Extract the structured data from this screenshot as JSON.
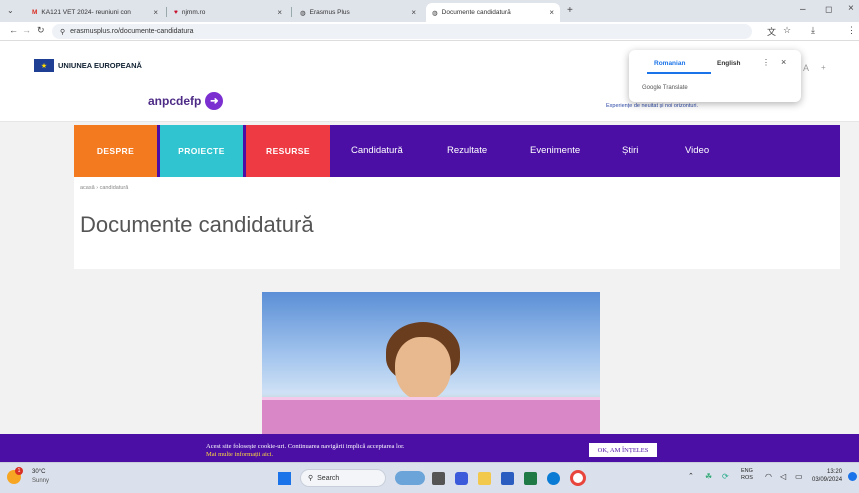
{
  "browser": {
    "tabs": [
      {
        "title": "KA121 VET 2024- reuniuni con"
      },
      {
        "title": "njmm.ro"
      },
      {
        "title": "Erasmus Plus"
      },
      {
        "title": "Documente candidatură"
      }
    ],
    "url": "erasmusplus.ro/documente-candidatura",
    "new_tab": "+",
    "close_glyph": "×"
  },
  "translate": {
    "source": "Romanian",
    "target": "English",
    "label": "Google Translate",
    "letter": "A",
    "plus": "+"
  },
  "site": {
    "eu_label": "UNIUNEA EUROPEANĂ",
    "logo_text": "anpcdefp",
    "tagline": "Experiențe de neuitat și noi orizonturi.",
    "nav_boxes": [
      {
        "label": "DESPRE",
        "color": "#f47a20"
      },
      {
        "label": "PROIECTE",
        "color": "#2fc4cf"
      },
      {
        "label": "RESURSE",
        "color": "#ee3a43"
      }
    ],
    "nav_links": [
      "Candidatură",
      "Rezultate",
      "Evenimente",
      "Știri",
      "Video"
    ],
    "breadcrumb": "acasă › candidatură",
    "page_title": "Documente candidatură"
  },
  "cookie": {
    "text": "Acest site folosește cookie-uri. Continuarea navigării implică acceptarea lor.",
    "link": "Mai multe informații aici.",
    "button": "OK, AM ÎNȚELES"
  },
  "taskbar": {
    "weather_temp": "30°C",
    "weather_desc": "Sunny",
    "search": "Search",
    "lang1": "ENG",
    "lang2": "ROS",
    "time": "13:20",
    "date": "03/09/2024",
    "weather_badge": "1"
  }
}
